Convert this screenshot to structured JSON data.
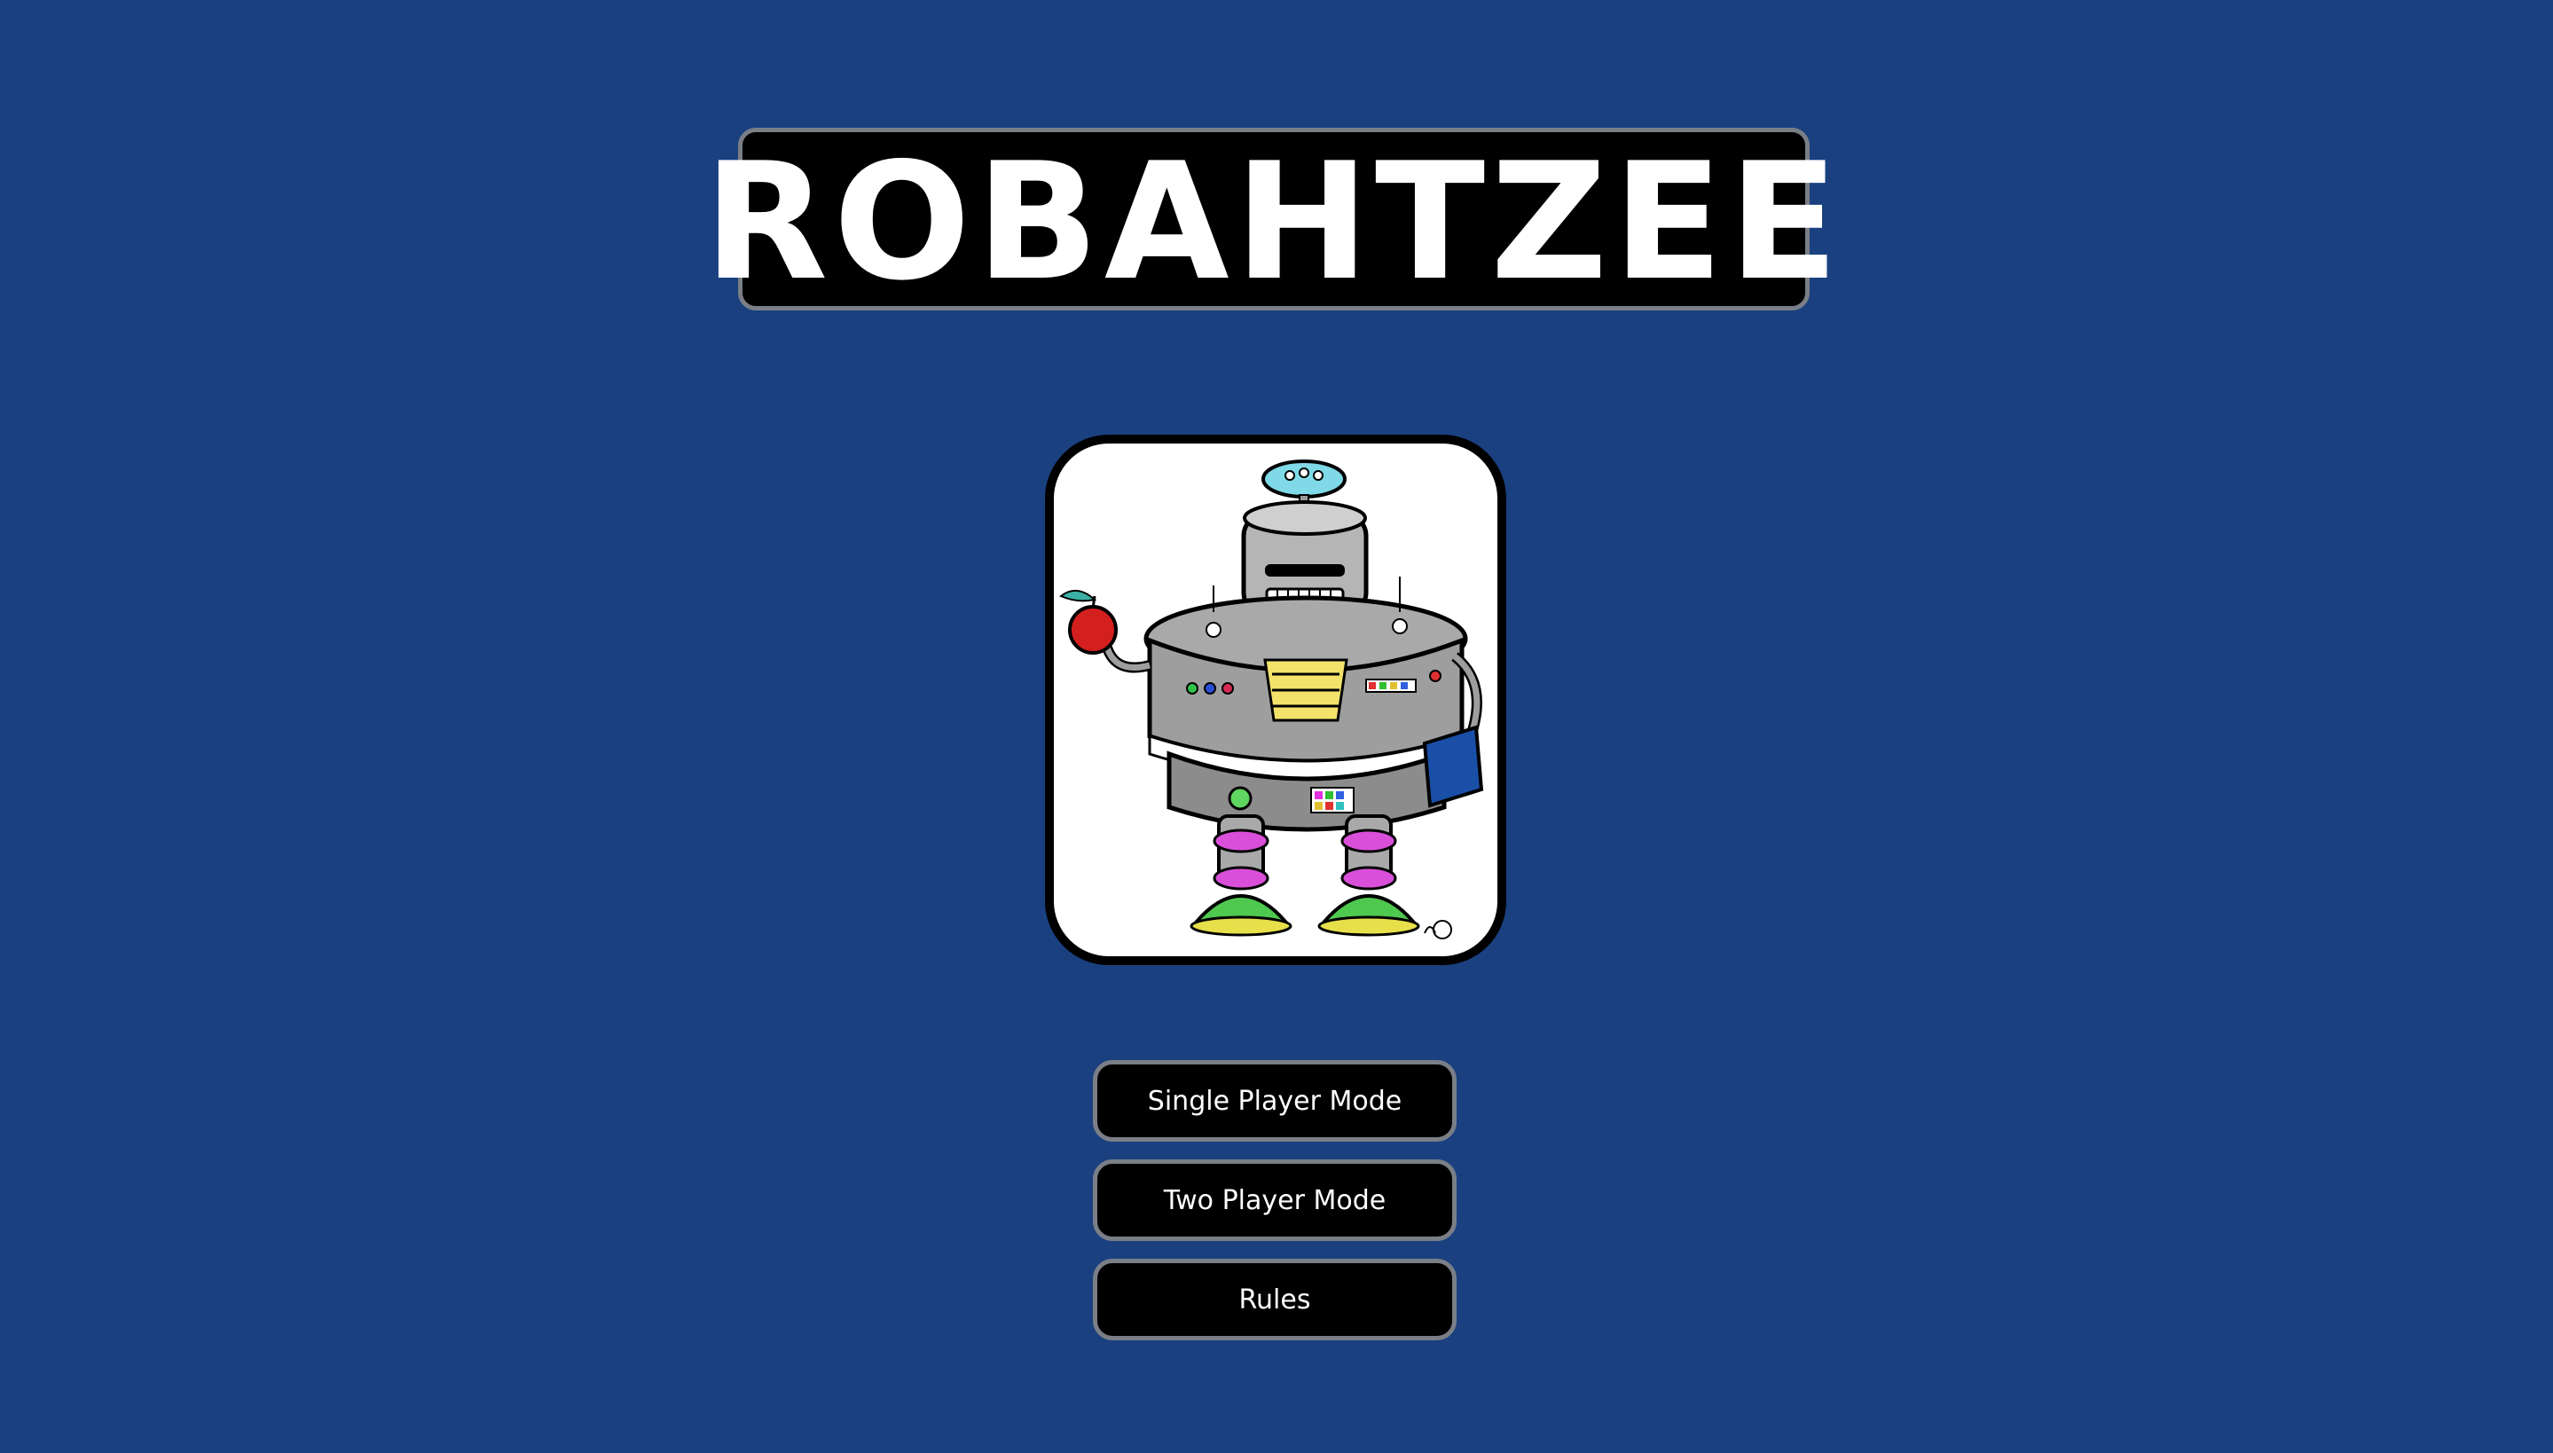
{
  "title": "ROBAHTZEE",
  "menu": {
    "single_player": "Single Player Mode",
    "two_player": "Two Player Mode",
    "rules": "Rules"
  },
  "colors": {
    "background": "#1a4080",
    "panel": "#000000",
    "panel_border": "#7a7f87",
    "text": "#ffffff"
  },
  "mascot": {
    "icon": "robot-mascot-icon",
    "holding": [
      "apple",
      "book"
    ]
  }
}
